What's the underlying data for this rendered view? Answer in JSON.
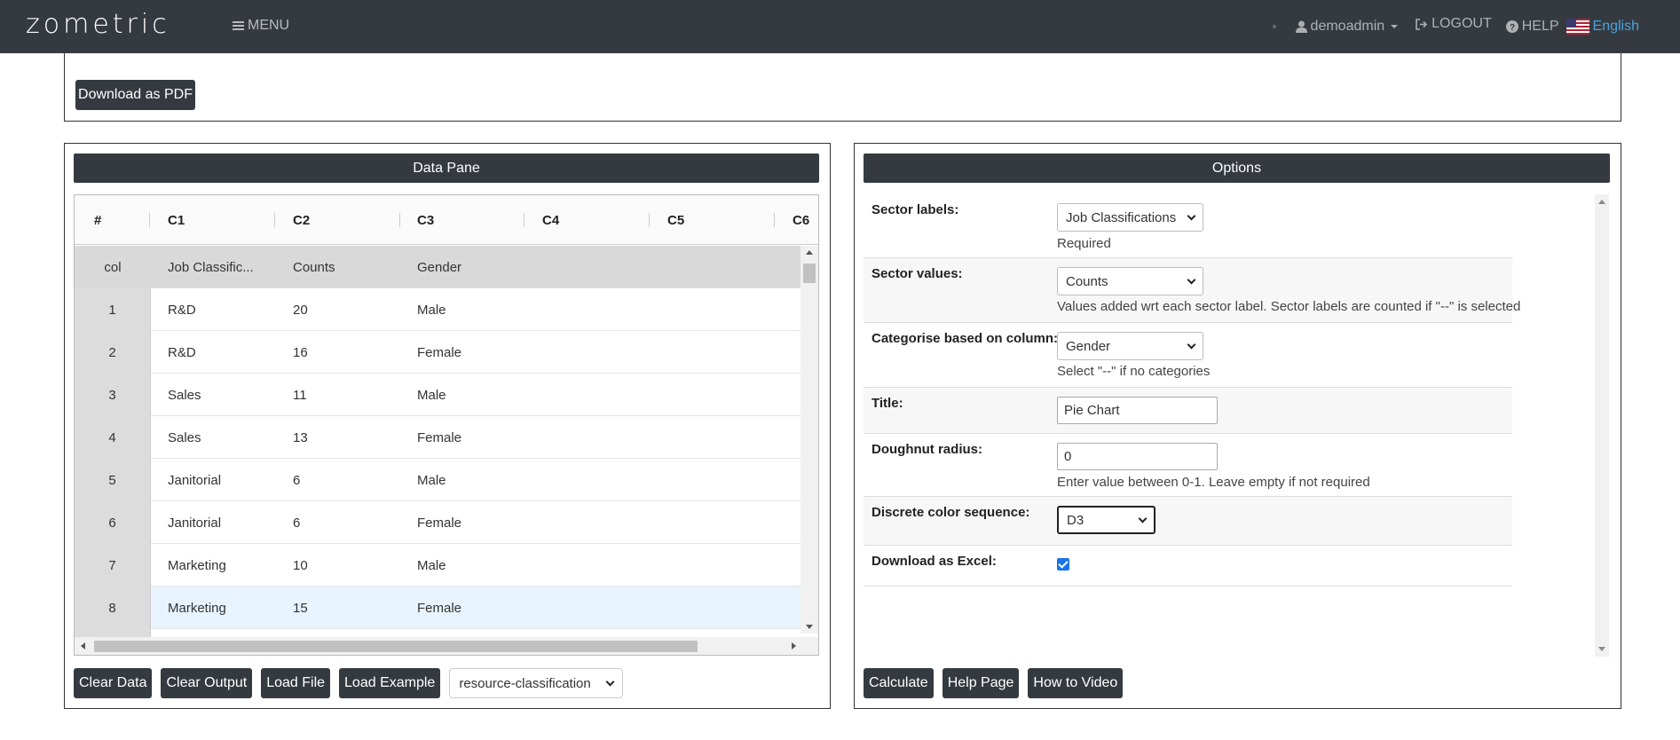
{
  "navbar": {
    "logo": "zometric",
    "menu_label": "MENU",
    "user_label": "demoadmin",
    "logout_label": "LOGOUT",
    "help_label": "HELP",
    "language_label": "English",
    "language_color": "#4aa3df"
  },
  "top": {
    "download_pdf_label": "Download as PDF"
  },
  "data_pane": {
    "title": "Data Pane",
    "columns": [
      "#",
      "C1",
      "C2",
      "C3",
      "C4",
      "C5",
      "C6"
    ],
    "col_type_row": {
      "index": "col",
      "c1": "Job Classific...",
      "c2": "Counts",
      "c3": "Gender"
    },
    "rows": [
      {
        "index": "1",
        "c1": "R&D",
        "c2": "20",
        "c3": "Male"
      },
      {
        "index": "2",
        "c1": "R&D",
        "c2": "16",
        "c3": "Female"
      },
      {
        "index": "3",
        "c1": "Sales",
        "c2": "11",
        "c3": "Male"
      },
      {
        "index": "4",
        "c1": "Sales",
        "c2": "13",
        "c3": "Female"
      },
      {
        "index": "5",
        "c1": "Janitorial",
        "c2": "6",
        "c3": "Male"
      },
      {
        "index": "6",
        "c1": "Janitorial",
        "c2": "6",
        "c3": "Female"
      },
      {
        "index": "7",
        "c1": "Marketing",
        "c2": "10",
        "c3": "Male"
      },
      {
        "index": "8",
        "c1": "Marketing",
        "c2": "15",
        "c3": "Female"
      }
    ],
    "buttons": {
      "clear_data": "Clear Data",
      "clear_output": "Clear Output",
      "load_file": "Load File",
      "load_example": "Load Example"
    },
    "example_select_value": "resource-classification"
  },
  "options": {
    "title": "Options",
    "sector_labels": {
      "label": "Sector labels:",
      "value": "Job Classifications",
      "help": "Required"
    },
    "sector_values": {
      "label": "Sector values:",
      "value": "Counts",
      "help": "Values added wrt each sector label. Sector labels are counted if \"--\" is selected"
    },
    "categorise": {
      "label": "Categorise based on column:",
      "value": "Gender",
      "help": "Select \"--\" if no categories"
    },
    "title_field": {
      "label": "Title:",
      "value": "Pie Chart"
    },
    "doughnut": {
      "label": "Doughnut radius:",
      "value": "0",
      "help": "Enter value between 0-1. Leave empty if not required"
    },
    "color_seq": {
      "label": "Discrete color sequence:",
      "value": "D3"
    },
    "download_excel": {
      "label": "Download as Excel:",
      "checked": true
    },
    "buttons": {
      "calculate": "Calculate",
      "help_page": "Help Page",
      "how_to_video": "How to Video"
    }
  },
  "colors": {
    "dark": "#343a40",
    "checkbox": "#1a73e8"
  }
}
